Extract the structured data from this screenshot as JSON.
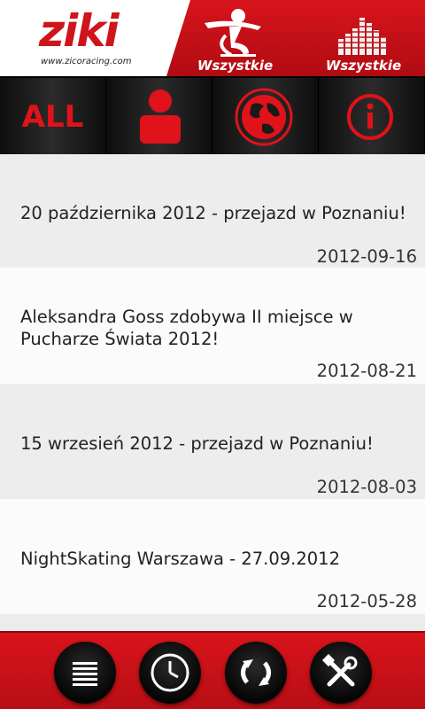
{
  "header": {
    "logo_text": "ziki",
    "logo_url": "www.zicoracing.com",
    "filter_skater": {
      "icon": "skater-icon",
      "label": "Wszystkie"
    },
    "filter_level": {
      "icon": "equalizer-icon",
      "label": "Wszystkie"
    }
  },
  "categories": [
    {
      "label": "ALL"
    },
    {
      "icon": "person-icon"
    },
    {
      "icon": "globe-icon"
    },
    {
      "icon": "info-icon"
    }
  ],
  "news": [
    {
      "title": "20 października 2012 - przejazd w Poznaniu!",
      "date": "2012-09-16"
    },
    {
      "title": "Aleksandra Goss zdobywa II miejsce w Pucharze Świata 2012!",
      "date": "2012-08-21"
    },
    {
      "title": "15 wrzesień 2012 - przejazd w Poznaniu!",
      "date": "2012-08-03"
    },
    {
      "title": "NightSkating Warszawa - 27.09.2012",
      "date": "2012-05-28"
    }
  ],
  "toolbar": [
    {
      "icon": "list-icon"
    },
    {
      "icon": "clock-icon"
    },
    {
      "icon": "refresh-icon"
    },
    {
      "icon": "tools-icon"
    }
  ],
  "colors": {
    "accent": "#d0141b",
    "dark": "#1a1a1a"
  }
}
